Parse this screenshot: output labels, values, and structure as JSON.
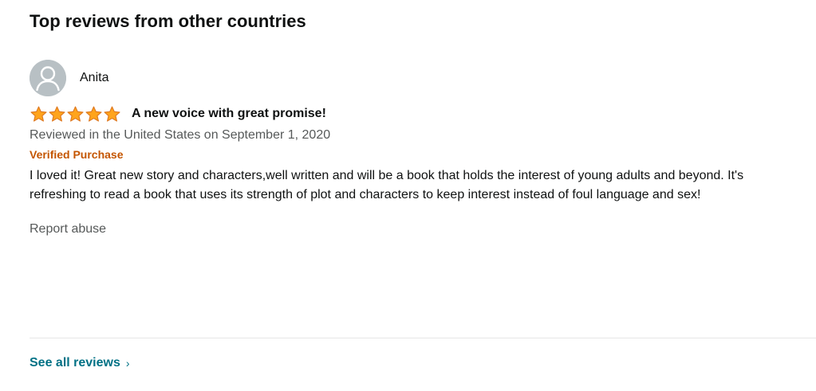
{
  "section": {
    "title": "Top reviews from other countries"
  },
  "review": {
    "reviewer_name": "Anita",
    "rating": 5,
    "rating_max": 5,
    "title": "A new voice with great promise!",
    "date_text": "Reviewed in the United States on September 1, 2020",
    "verified_label": "Verified Purchase",
    "body": "I loved it! Great new story and characters,well written and will be a book that holds the interest of young adults and beyond. It's refreshing to read a book that uses its strength of plot and characters to keep interest instead of foul language and sex!",
    "report_label": "Report abuse"
  },
  "footer": {
    "see_all_label": "See all reviews",
    "chevron": "›"
  },
  "colors": {
    "star": "#ffa41c",
    "star_stroke": "#de7921",
    "verified": "#c45500",
    "link": "#007185",
    "muted": "#565959",
    "avatar_bg": "#b8c0c4"
  },
  "icons": {
    "avatar": "default-user-icon",
    "star": "star-icon",
    "chevron": "chevron-right-icon"
  }
}
